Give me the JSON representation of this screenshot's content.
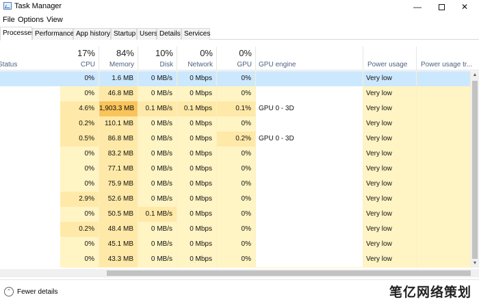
{
  "window": {
    "title": "Task Manager",
    "min_glyph": "—",
    "close_glyph": "✕"
  },
  "menu": [
    "File",
    "Options",
    "View"
  ],
  "tabs": [
    "Processes",
    "Performance",
    "App history",
    "Startup",
    "Users",
    "Details",
    "Services"
  ],
  "active_tab": "Processes",
  "header": {
    "status": "Status",
    "cpu": {
      "pct": "17%",
      "label": "CPU"
    },
    "memory": {
      "pct": "84%",
      "label": "Memory"
    },
    "disk": {
      "pct": "10%",
      "label": "Disk"
    },
    "network": {
      "pct": "0%",
      "label": "Network"
    },
    "gpu": {
      "pct": "0%",
      "label": "GPU"
    },
    "gpu_engine": "GPU engine",
    "power_usage": "Power usage",
    "power_usage_trend": "Power usage tr..."
  },
  "rows": [
    {
      "cpu": "0%",
      "memory": "1.6 MB",
      "disk": "0 MB/s",
      "network": "0 Mbps",
      "gpu": "0%",
      "gpu_engine": "",
      "power": "Very low",
      "selected": true
    },
    {
      "cpu": "0%",
      "memory": "46.8 MB",
      "disk": "0 MB/s",
      "network": "0 Mbps",
      "gpu": "0%",
      "gpu_engine": "",
      "power": "Very low"
    },
    {
      "cpu": "4.6%",
      "memory": "1,903.3 MB",
      "disk": "0.1 MB/s",
      "network": "0.1 Mbps",
      "gpu": "0.1%",
      "gpu_engine": "GPU 0 - 3D",
      "power": "Very low",
      "mem_high": true
    },
    {
      "cpu": "0.2%",
      "memory": "110.1 MB",
      "disk": "0 MB/s",
      "network": "0 Mbps",
      "gpu": "0%",
      "gpu_engine": "",
      "power": "Very low"
    },
    {
      "cpu": "0.5%",
      "memory": "86.8 MB",
      "disk": "0 MB/s",
      "network": "0 Mbps",
      "gpu": "0.2%",
      "gpu_engine": "GPU 0 - 3D",
      "power": "Very low"
    },
    {
      "cpu": "0%",
      "memory": "83.2 MB",
      "disk": "0 MB/s",
      "network": "0 Mbps",
      "gpu": "0%",
      "gpu_engine": "",
      "power": "Very low"
    },
    {
      "cpu": "0%",
      "memory": "77.1 MB",
      "disk": "0 MB/s",
      "network": "0 Mbps",
      "gpu": "0%",
      "gpu_engine": "",
      "power": "Very low"
    },
    {
      "cpu": "0%",
      "memory": "75.9 MB",
      "disk": "0 MB/s",
      "network": "0 Mbps",
      "gpu": "0%",
      "gpu_engine": "",
      "power": "Very low"
    },
    {
      "cpu": "2.9%",
      "memory": "52.6 MB",
      "disk": "0 MB/s",
      "network": "0 Mbps",
      "gpu": "0%",
      "gpu_engine": "",
      "power": "Very low"
    },
    {
      "cpu": "0%",
      "memory": "50.5 MB",
      "disk": "0.1 MB/s",
      "network": "0 Mbps",
      "gpu": "0%",
      "gpu_engine": "",
      "power": "Very low"
    },
    {
      "cpu": "0.2%",
      "memory": "48.4 MB",
      "disk": "0 MB/s",
      "network": "0 Mbps",
      "gpu": "0%",
      "gpu_engine": "",
      "power": "Very low"
    },
    {
      "cpu": "0%",
      "memory": "45.1 MB",
      "disk": "0 MB/s",
      "network": "0 Mbps",
      "gpu": "0%",
      "gpu_engine": "",
      "power": "Very low"
    },
    {
      "cpu": "0%",
      "memory": "43.3 MB",
      "disk": "0 MB/s",
      "network": "0 Mbps",
      "gpu": "0%",
      "gpu_engine": "",
      "power": "Very low"
    }
  ],
  "footer": {
    "fewer_details": "Fewer details",
    "fewer_icon": "⌃"
  },
  "watermark": "笔亿网络策划",
  "colors": {
    "heat_light": "#fff4c4",
    "heat_mid": "#ffe9a8",
    "heat_strong": "#f9c45b",
    "selection": "#cce8ff",
    "header_label": "#4d6082"
  }
}
